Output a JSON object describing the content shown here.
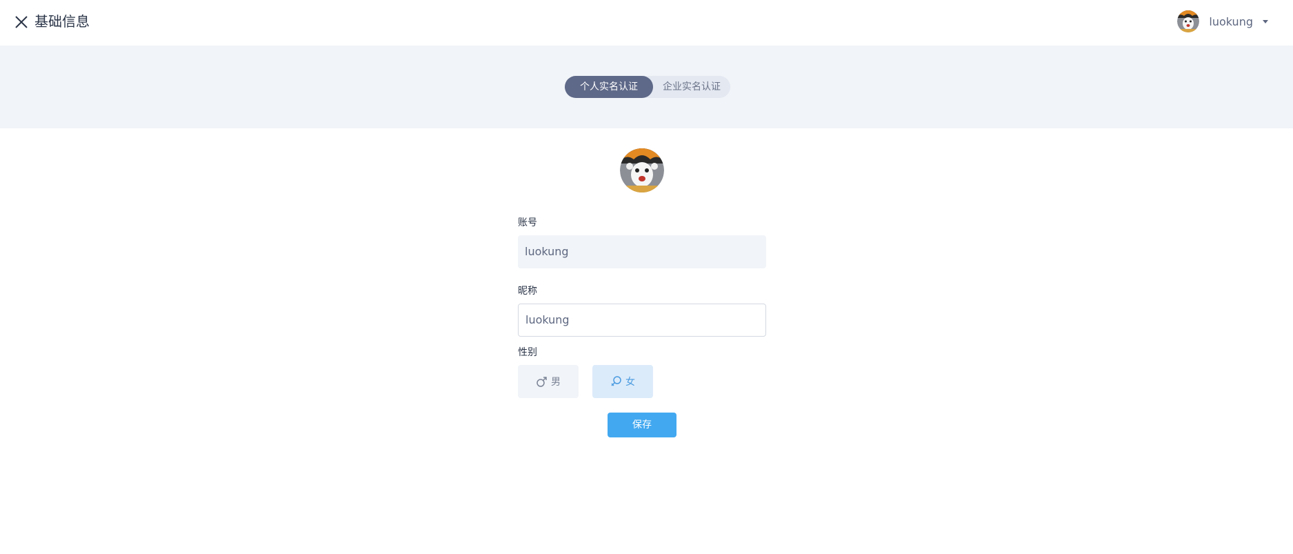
{
  "header": {
    "title": "基础信息",
    "close_icon": "close-icon",
    "user": {
      "name": "luokung",
      "avatar_icon": "avatar-image"
    }
  },
  "tabs": [
    {
      "label": "个人实名认证",
      "active": true
    },
    {
      "label": "企业实名认证",
      "active": false
    }
  ],
  "form": {
    "account": {
      "label": "账号",
      "value": "luokung"
    },
    "nickname": {
      "label": "昵称",
      "value": "luokung"
    },
    "gender": {
      "label": "性别",
      "options": [
        {
          "label": "男",
          "icon": "male-icon",
          "selected": false
        },
        {
          "label": "女",
          "icon": "female-icon",
          "selected": true
        }
      ]
    },
    "save_label": "保存"
  },
  "colors": {
    "accent": "#42a8f0",
    "tab_active": "#5e6888",
    "band_bg": "#f1f4f8",
    "female_selected_bg": "#dcebfa"
  }
}
